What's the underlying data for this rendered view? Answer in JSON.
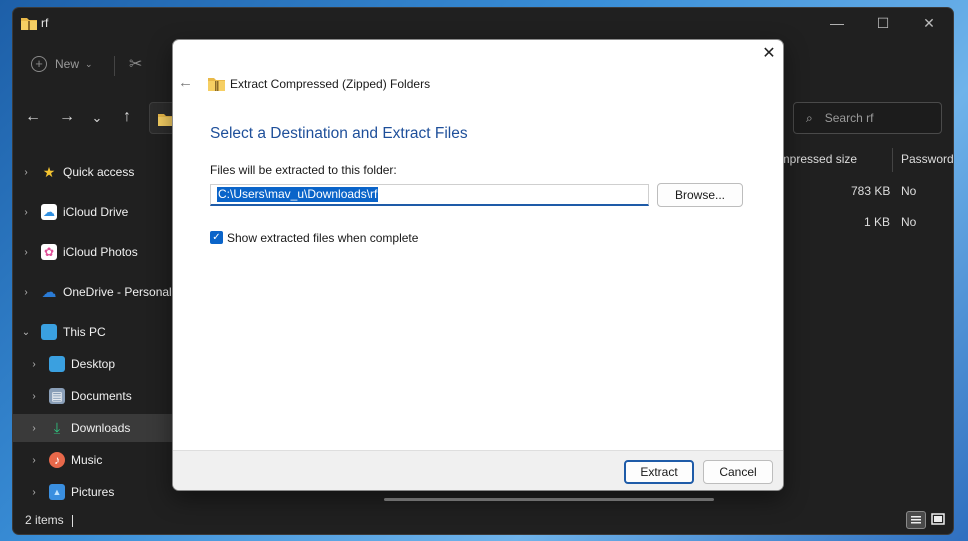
{
  "explorer": {
    "title": "rf",
    "window_controls": {
      "minimize": "—",
      "maximize": "☐",
      "close": "✕"
    },
    "toolbar": {
      "new_label": "New",
      "new_icon": "plus-circle-icon",
      "chevron": "⌄",
      "cut_glyph": "✂"
    },
    "nav": {
      "back": "←",
      "forward": "→",
      "recent": "⌄",
      "up": "↑"
    },
    "search": {
      "placeholder": "Search rf",
      "icon": "⌕"
    },
    "sidebar": [
      {
        "label": "Quick access",
        "icon": "star",
        "glyph": "★",
        "color": "#f4c430",
        "expander": "›"
      },
      {
        "label": "iCloud Drive",
        "icon": "icloud-drive",
        "glyph": "☁",
        "color": "#2f8fe0",
        "expander": "›"
      },
      {
        "label": "iCloud Photos",
        "icon": "icloud-photos",
        "glyph": "✿",
        "color": "#e0529a",
        "expander": "›"
      },
      {
        "label": "OneDrive - Personal",
        "icon": "onedrive",
        "glyph": "☁",
        "color": "#2a7bd6",
        "expander": "›"
      },
      {
        "label": "This PC",
        "icon": "this-pc",
        "glyph": "▭",
        "color": "#3aa0e0",
        "expander": "⌄"
      },
      {
        "label": "Desktop",
        "icon": "desktop",
        "glyph": "▬",
        "color": "#3aa0e0",
        "expander": "›"
      },
      {
        "label": "Documents",
        "icon": "documents",
        "glyph": "▤",
        "color": "#8a9fb8",
        "expander": "›"
      },
      {
        "label": "Downloads",
        "icon": "downloads",
        "glyph": "⤓",
        "color": "#2ec27e",
        "expander": "›"
      },
      {
        "label": "Music",
        "icon": "music",
        "glyph": "♪",
        "color": "#e8684a",
        "expander": "›"
      },
      {
        "label": "Pictures",
        "icon": "pictures",
        "glyph": "▲",
        "color": "#3a8fe0",
        "expander": "›"
      }
    ],
    "columns": {
      "compressed_size": "ompressed size",
      "password": "Password"
    },
    "files": [
      {
        "size": "783 KB",
        "password": "No"
      },
      {
        "size": "1 KB",
        "password": "No"
      }
    ],
    "status": {
      "items": "2 items"
    }
  },
  "dialog": {
    "close_glyph": "✕",
    "back_glyph": "←",
    "title": "Extract Compressed (Zipped) Folders",
    "heading": "Select a Destination and Extract Files",
    "label": "Files will be extracted to this folder:",
    "path": "C:\\Users\\mav_u\\Downloads\\rf",
    "browse": "Browse...",
    "checkbox": {
      "label": "Show extracted files when complete",
      "checked": true,
      "glyph": "✓"
    },
    "extract": "Extract",
    "cancel": "Cancel"
  },
  "colors": {
    "accent": "#0a64c9",
    "heading": "#1e4f9a",
    "explorer_bg": "#202020"
  }
}
